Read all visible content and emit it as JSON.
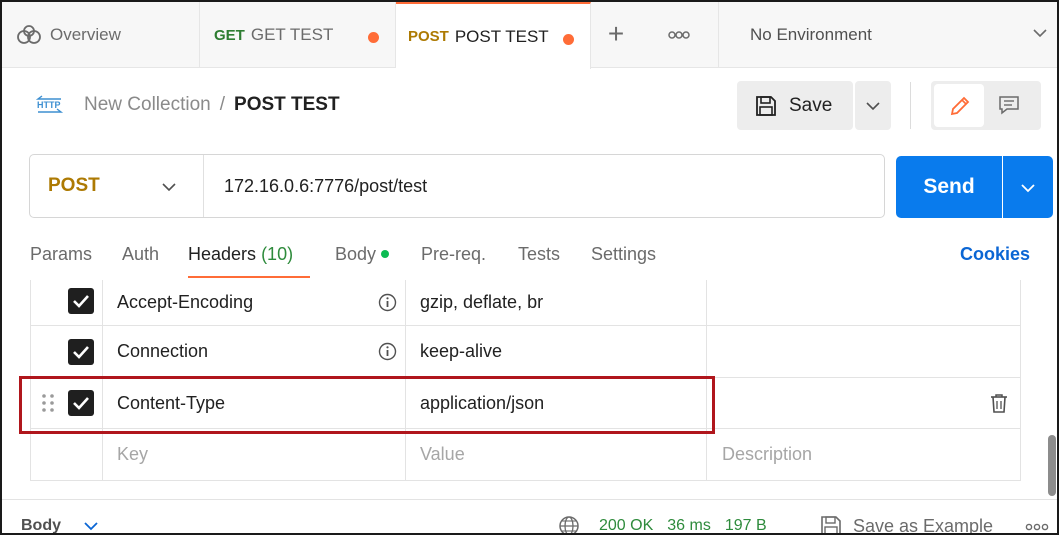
{
  "tabs": {
    "overview_label": "Overview",
    "get_method": "GET",
    "get_label": "GET TEST",
    "post_method": "POST",
    "post_label": "POST TEST",
    "plus": "+",
    "environment": "No Environment"
  },
  "breadcrumb": {
    "collection": "New Collection",
    "separator": "/",
    "request": "POST TEST"
  },
  "toolbar": {
    "save_label": "Save"
  },
  "request": {
    "method": "POST",
    "url": "172.16.0.6:7776/post/test",
    "send_label": "Send"
  },
  "request_tabs": {
    "params": "Params",
    "auth": "Auth",
    "headers": "Headers",
    "headers_count": "(10)",
    "body": "Body",
    "prereq": "Pre-req.",
    "tests": "Tests",
    "settings": "Settings",
    "cookies": "Cookies"
  },
  "headers": [
    {
      "key": "Accept-Encoding",
      "value": "gzip, deflate, br",
      "checked": true
    },
    {
      "key": "Connection",
      "value": "keep-alive",
      "checked": true
    },
    {
      "key": "Content-Type",
      "value": "application/json",
      "checked": true
    }
  ],
  "placeholders": {
    "key": "Key",
    "value": "Value",
    "description": "Description"
  },
  "response": {
    "body_label": "Body",
    "status": "200 OK",
    "time": "36 ms",
    "size": "197 B",
    "save_example": "Save as Example"
  },
  "colors": {
    "accent_orange": "#ff6c37",
    "send_blue": "#097bed",
    "post_method": "#ad7a03",
    "get_method": "#2e7d32",
    "status_green": "#2e8b3c",
    "highlight_red": "#b0161c"
  }
}
